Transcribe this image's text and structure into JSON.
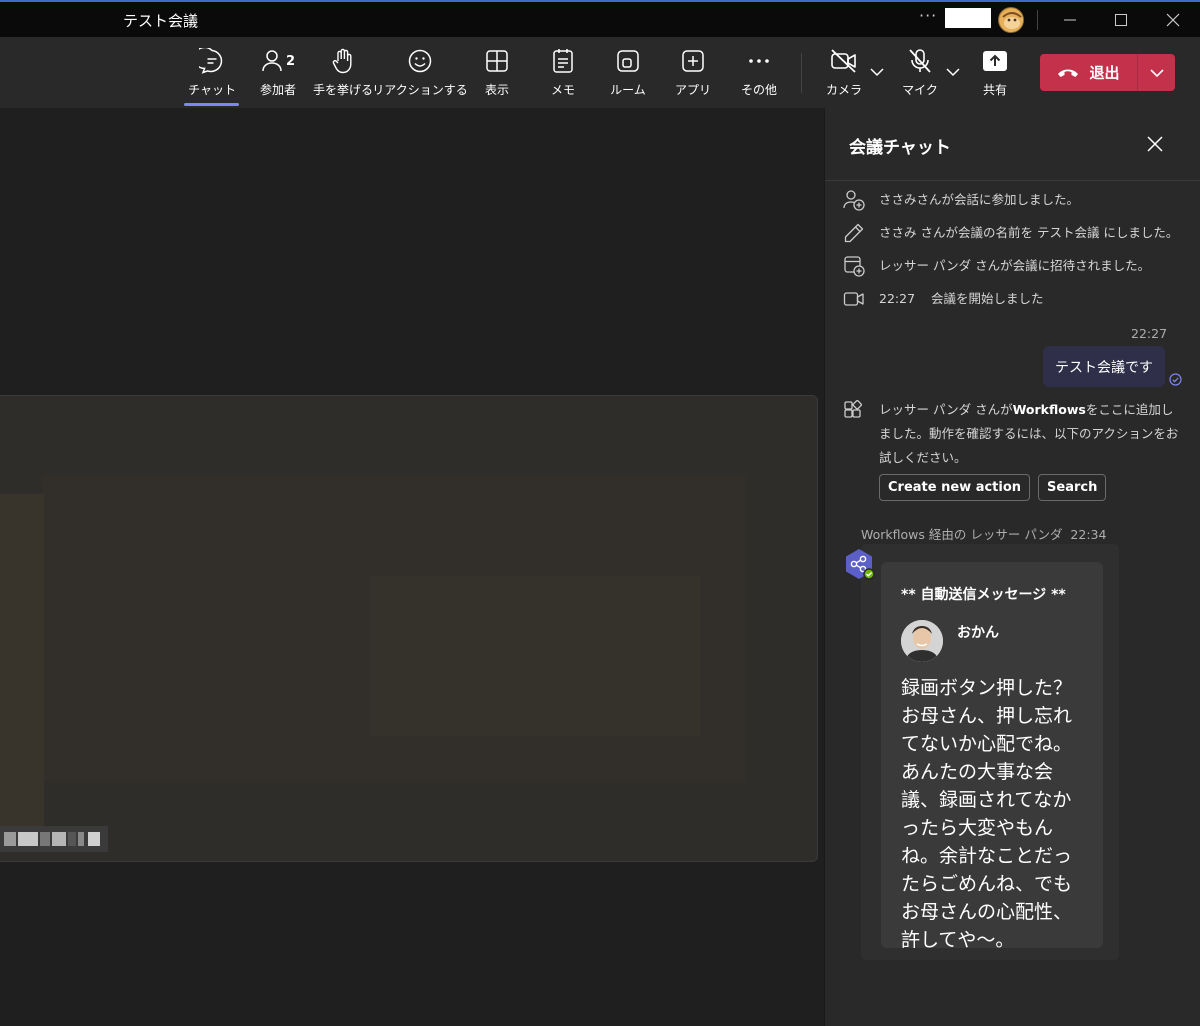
{
  "window": {
    "title": "テスト会議",
    "more_label": "···"
  },
  "toolbar": {
    "chat_label": "チャット",
    "participants_label": "参加者",
    "participants_count": "2",
    "raise_hand_label": "手を挙げる",
    "reactions_label": "リアクションする",
    "view_label": "表示",
    "notes_label": "メモ",
    "rooms_label": "ルーム",
    "apps_label": "アプリ",
    "more_label": "その他",
    "camera_label": "カメラ",
    "mic_label": "マイク",
    "share_label": "共有",
    "leave_label": "退出"
  },
  "chat": {
    "title": "会議チャット",
    "system": [
      {
        "icon": "person-add-icon",
        "text": "ささみさんが会話に参加しました。"
      },
      {
        "icon": "pencil-icon",
        "text": "ささみ さんが会議の名前を テスト会議 にしました。"
      },
      {
        "icon": "calendar-add-icon",
        "text": "レッサー パンダ さんが会議に招待されました。"
      },
      {
        "icon": "video-icon",
        "time": "22:27",
        "text": "会議を開始しました"
      }
    ],
    "my_message": {
      "time": "22:27",
      "text": "テスト会議です"
    },
    "workflow_notice": {
      "text_prefix": "レッサー パンダ さんが",
      "text_bold": "Workflows",
      "text_suffix": "をここに追加しました。動作を確認するには、以下のアクションをお試しください。",
      "actions": [
        "Create new action",
        "Search"
      ]
    },
    "bot_message": {
      "meta": "Workflows 経由の レッサー パンダ",
      "time": "22:34",
      "card_header": "** 自動送信メッセージ **",
      "sender": "おかん",
      "body": "録画ボタン押した？お母さん、押し忘れてないか心配でね。あんたの大事な会議、録画されてなかったら大変やもんね。余計なことだったらごめんね、でもお母さんの心配性、許してや〜。"
    }
  },
  "colors": {
    "accent": "#7f85f5",
    "leave": "#c4314b",
    "background": "#1f1f1f",
    "panel": "#292929"
  }
}
